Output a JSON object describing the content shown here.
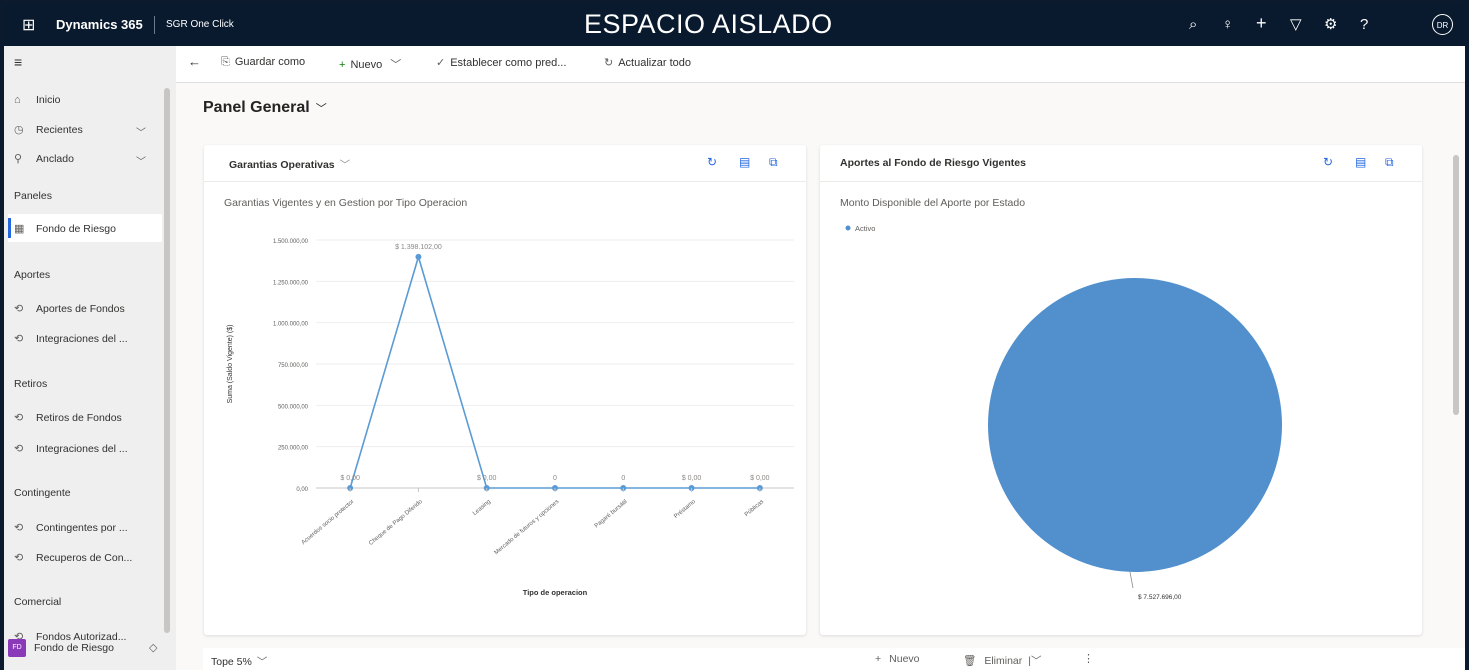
{
  "topbar": {
    "app_name": "Dynamics 365",
    "environment": "SGR One Click",
    "sandbox_label": "ESPACIO AISLADO",
    "avatar_initials": "DR"
  },
  "commandbar": {
    "save_as": "Guardar como",
    "new": "Nuevo",
    "set_default": "Establecer como pred...",
    "refresh_all": "Actualizar todo"
  },
  "sidebar": {
    "home": "Inicio",
    "recent": "Recientes",
    "pinned": "Anclado",
    "section_paneles": "Paneles",
    "fondo_riesgo": "Fondo de Riesgo",
    "section_aportes": "Aportes",
    "aportes_fondos": "Aportes de Fondos",
    "integraciones_1": "Integraciones del ...",
    "section_retiros": "Retiros",
    "retiros_fondos": "Retiros de Fondos",
    "integraciones_2": "Integraciones del ...",
    "section_contingente": "Contingente",
    "contingentes": "Contingentes por ...",
    "recuperos": "Recuperos de Con...",
    "section_comercial": "Comercial",
    "fondos_autorizados": "Fondos Autorizad...",
    "area_initials": "FD",
    "area_name": "Fondo de Riesgo"
  },
  "page": {
    "title": "Panel General"
  },
  "card1": {
    "title": "Garantias Operativas",
    "chart_subtitle": "Garantias Vigentes y en Gestion por Tipo Operacion"
  },
  "card2": {
    "title": "Aportes al Fondo de Riesgo Vigentes",
    "chart_subtitle": "Monto Disponible del Aporte por Estado"
  },
  "bottom": {
    "view_name": "Tope 5%",
    "new": "Nuevo",
    "delete": "Eliminar"
  },
  "colors": {
    "series": "#5b9bd5",
    "pie": "#5190cd",
    "accent": "#2266e3",
    "topbar": "#0a1a2e"
  },
  "chart_data": [
    {
      "type": "line",
      "title": "Garantias Vigentes y en Gestion por Tipo Operacion",
      "xlabel": "Tipo de operacion",
      "ylabel": "Suma (Saldo Vigente) ($)",
      "ylim": [
        0,
        1500000
      ],
      "yticks": [
        "0,00",
        "250.000,00",
        "500.000,00",
        "750.000,00",
        "1.000.000,00",
        "1.250.000,00",
        "1.500.000,00"
      ],
      "categories": [
        "Acuerdos socio protector",
        "Cheque de Pago Diferido",
        "Leasing",
        "Mercado de futuros y opciones",
        "Pagaré bursátil",
        "Préstamo",
        "Públicas"
      ],
      "values": [
        0,
        1398102,
        0,
        0,
        0,
        0,
        0
      ],
      "data_labels": [
        "$ 0,00",
        "$ 1.398.102,00",
        "$ 0,00",
        "0",
        "0",
        "$ 0,00",
        "$ 0,00"
      ]
    },
    {
      "type": "pie",
      "title": "Monto Disponible del Aporte por Estado",
      "legend": [
        "Activo"
      ],
      "categories": [
        "Activo"
      ],
      "values": [
        7527696
      ],
      "data_labels": [
        "$ 7.527.696,00"
      ]
    }
  ]
}
